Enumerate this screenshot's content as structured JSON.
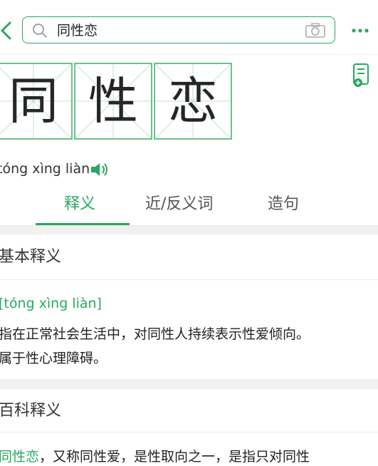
{
  "search": {
    "query": "同性恋"
  },
  "word": {
    "chars": [
      "同",
      "性",
      "恋"
    ],
    "pinyin": "tóng xìng liàn"
  },
  "tabs": [
    {
      "label": "释义",
      "active": true
    },
    {
      "label": "近/反义词",
      "active": false
    },
    {
      "label": "造句",
      "active": false
    }
  ],
  "basic": {
    "title": "基本释义",
    "pinyin": "[tóng xìng liàn]",
    "line1": "指在正常社会生活中，对同性人持续表示性爱倾向。",
    "line2": "属于性心理障碍。"
  },
  "baike": {
    "title": "百科释义",
    "lead": "同性恋",
    "rest": "，又称同性爱，是性取向之一，是指只对同性"
  },
  "colors": {
    "accent": "#27a85f"
  },
  "icons": [
    "back-arrow-icon",
    "search-icon",
    "camera-icon",
    "more-dots-icon",
    "note-add-icon",
    "speaker-icon"
  ]
}
